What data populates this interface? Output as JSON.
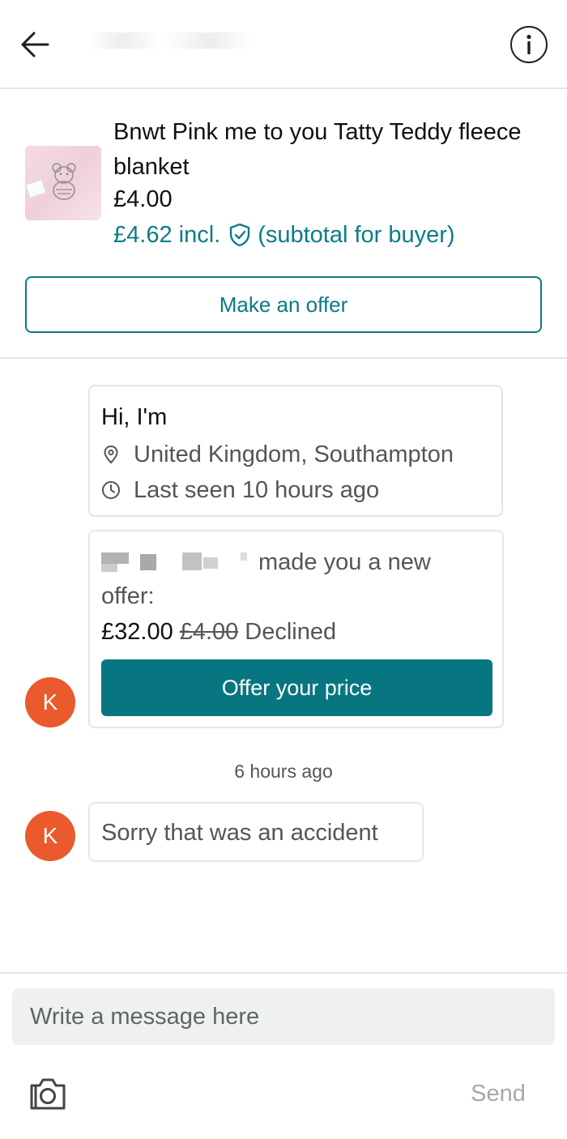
{
  "header": {
    "back_icon": "arrow-left-icon",
    "info_icon": "info-icon"
  },
  "item": {
    "title": "Bnwt Pink me to you Tatty Teddy fleece blanket",
    "price": "£4.00",
    "price_incl": "£4.62 incl.",
    "buyer_note": "(subtotal for buyer)",
    "make_offer_label": "Make an offer"
  },
  "intro": {
    "greeting": "Hi, I'm",
    "location": "United Kingdom, Southampton",
    "last_seen": "Last seen 10 hours ago"
  },
  "offer": {
    "text_line1": "made you a new",
    "text_line2": "offer:",
    "new_price": "£32.00",
    "old_price": "£4.00",
    "status": "Declined",
    "button_label": "Offer your price"
  },
  "avatar": {
    "initial": "K",
    "color": "#ea5a2c"
  },
  "messages": {
    "timestamp": "6 hours ago",
    "text": "Sorry that was an accident"
  },
  "composer": {
    "placeholder": "Write a message here",
    "send_label": "Send",
    "camera_icon": "camera-icon"
  },
  "colors": {
    "accent": "#0b7a82",
    "primary_button": "#087681",
    "avatar": "#ea5a2c"
  }
}
